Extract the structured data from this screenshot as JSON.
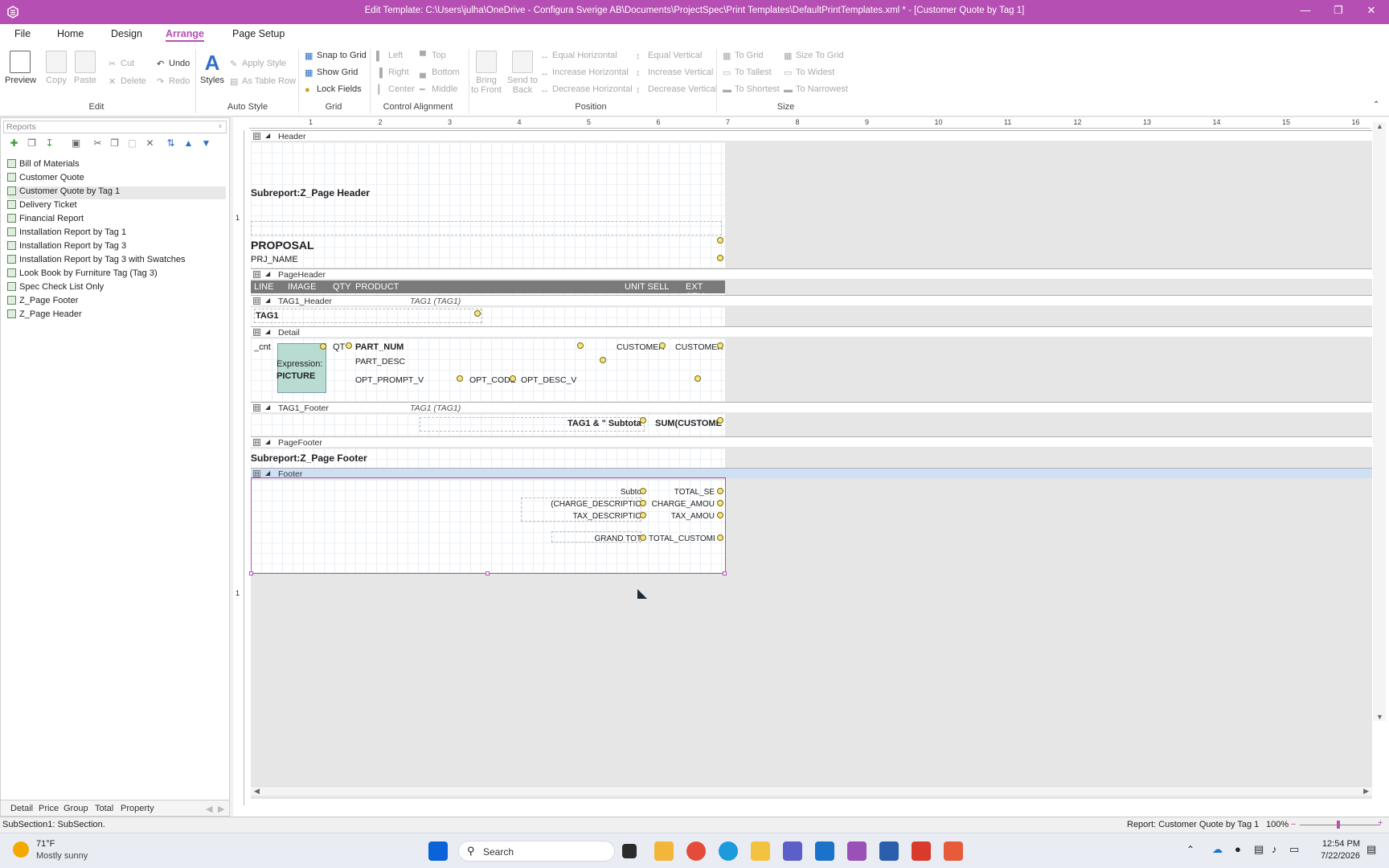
{
  "window": {
    "title": "Edit Template:  C:\\Users\\julha\\OneDrive - Configura Sverige AB\\Documents\\ProjectSpec\\Print Templates\\DefaultPrintTemplates.xml * - [Customer Quote by Tag 1]",
    "accent": "#b64fb3"
  },
  "menu_tabs": [
    "File",
    "Home",
    "Design",
    "Arrange",
    "Page Setup"
  ],
  "active_tab": "Arrange",
  "ribbon": {
    "preview": "Preview",
    "copy": "Copy",
    "paste": "Paste",
    "cut": "Cut",
    "delete": "Delete",
    "undo": "Undo",
    "redo": "Redo",
    "edit_group": "Edit",
    "styles": "Styles",
    "apply_style": "Apply Style",
    "as_table_row": "As Table Row",
    "auto_style_group": "Auto Style",
    "snap_to_grid": "Snap to Grid",
    "show_grid": "Show Grid",
    "lock_fields": "Lock Fields",
    "grid_group": "Grid",
    "left": "Left",
    "right": "Right",
    "center": "Center",
    "top": "Top",
    "bottom": "Bottom",
    "middle": "Middle",
    "control_alignment_group": "Control Alignment",
    "bring_to_front_1": "Bring",
    "bring_to_front_2": "to Front",
    "send_to_back_1": "Send to",
    "send_to_back_2": "Back",
    "equal_horizontal": "Equal Horizontal",
    "increase_horizontal": "Increase Horizontal",
    "decrease_horizontal": "Decrease Horizontal",
    "equal_vertical": "Equal Vertical",
    "increase_vertical": "Increase Vertical",
    "decrease_vertical": "Decrease Vertical",
    "position_group": "Position",
    "to_grid": "To Grid",
    "to_tallest": "To Tallest",
    "to_shortest": "To Shortest",
    "size_to_grid": "Size To Grid",
    "to_widest": "To Widest",
    "to_narrowest": "To Narrowest",
    "size_group": "Size"
  },
  "left_panel": {
    "header": "Reports",
    "items": [
      "Bill of Materials",
      "Customer Quote",
      "Customer Quote by Tag 1",
      "Delivery Ticket",
      "Financial Report",
      "Installation Report by Tag 1",
      "Installation Report by Tag 3",
      "Installation Report by Tag 3 with Swatches",
      "Look Book by Furniture Tag (Tag 3)",
      "Spec Check List Only",
      "Z_Page Footer",
      "Z_Page Header"
    ],
    "selected": "Customer Quote by Tag 1",
    "bottom_tabs": [
      "Detail",
      "Price",
      "Group",
      "Total",
      "Property"
    ]
  },
  "ruler": {
    "ticks": [
      "1",
      "2",
      "3",
      "4",
      "5",
      "6",
      "7",
      "8",
      "9",
      "10",
      "11",
      "12",
      "13",
      "14",
      "15",
      "16"
    ],
    "left_ticks": [
      "1",
      "1"
    ]
  },
  "bands": {
    "header": "Header",
    "page_header": "PageHeader",
    "tag1_header": "TAG1_Header",
    "tag1_header_group": "TAG1 (TAG1)",
    "detail": "Detail",
    "tag1_footer": "TAG1_Footer",
    "tag1_footer_group": "TAG1 (TAG1)",
    "page_footer": "PageFooter",
    "footer": "Footer"
  },
  "fields": {
    "subreport_header": "Subreport:Z_Page Header",
    "proposal": "PROPOSAL",
    "prj_name": "PRJ_NAME",
    "col_line": "LINE",
    "col_image": "IMAGE",
    "col_qty": "QTY",
    "col_product": "PRODUCT",
    "col_unit_sell": "UNIT SELL",
    "col_ext_sell": "EXT SELL",
    "tag1": "TAG1",
    "cnt": "_cnt",
    "expression_1": "Expression:",
    "expression_2": "PICTURE",
    "qty_field": "QT",
    "part_num": "PART_NUM",
    "part_desc": "PART_DESC",
    "opt_prompt_v": "OPT_PROMPT_V",
    "opt_code": "OPT_CODE",
    "opt_desc_v": "OPT_DESC_V",
    "customer_1": "CUSTOMER",
    "customer_2": "CUSTOMER",
    "tag1_subtotal": "TAG1 & \"  Subtota",
    "sum_customer": "SUM(CUSTOME",
    "subreport_footer": "Subreport:Z_Page Footer",
    "subto": "Subto",
    "total_se": "TOTAL_SE",
    "charge_description": "(CHARGE_DESCRIPTIO",
    "charge_amount": "CHARGE_AMOU",
    "tax_description": "TAX_DESCRIPTIO",
    "tax_amount": "TAX_AMOU",
    "grand_tot": "GRAND TOT",
    "total_customer": "TOTAL_CUSTOME"
  },
  "status": {
    "left": "SubSection1: SubSection.",
    "report": "Report: Customer Quote by Tag 1",
    "zoom": "100%"
  },
  "taskbar": {
    "weather_temp": "71°F",
    "weather_desc": "Mostly sunny",
    "search_placeholder": "Search",
    "time": "12:54 PM",
    "date": "7/22/2026"
  }
}
